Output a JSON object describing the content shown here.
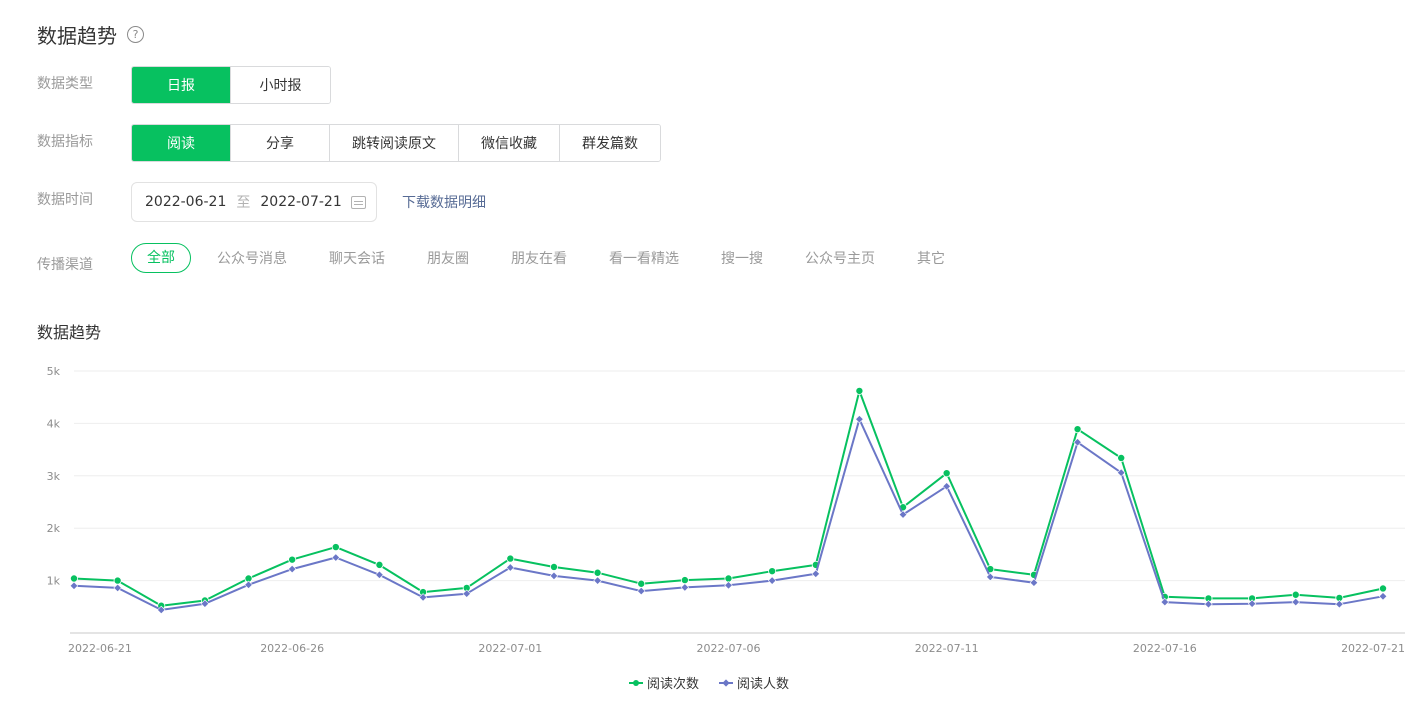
{
  "header": {
    "title": "数据趋势",
    "help_icon": "question-circle-icon"
  },
  "filters": {
    "type": {
      "label": "数据类型",
      "options": [
        "日报",
        "小时报"
      ],
      "selected": "日报"
    },
    "metric": {
      "label": "数据指标",
      "options": [
        "阅读",
        "分享",
        "跳转阅读原文",
        "微信收藏",
        "群发篇数"
      ],
      "selected": "阅读"
    },
    "time": {
      "label": "数据时间",
      "start": "2022-06-21",
      "separator": "至",
      "end": "2022-07-21",
      "calendar_icon": "calendar-icon",
      "download_label": "下载数据明细"
    },
    "channel": {
      "label": "传播渠道",
      "options": [
        "全部",
        "公众号消息",
        "聊天会话",
        "朋友圈",
        "朋友在看",
        "看一看精选",
        "搜一搜",
        "公众号主页",
        "其它"
      ],
      "selected": "全部"
    }
  },
  "colors": {
    "accent": "#07c160",
    "series2": "#6b77c7",
    "link": "#576b95"
  },
  "chart_data": {
    "type": "line",
    "title": "数据趋势",
    "x": [
      "2022-06-21",
      "2022-06-22",
      "2022-06-23",
      "2022-06-24",
      "2022-06-25",
      "2022-06-26",
      "2022-06-27",
      "2022-06-28",
      "2022-06-29",
      "2022-06-30",
      "2022-07-01",
      "2022-07-02",
      "2022-07-03",
      "2022-07-04",
      "2022-07-05",
      "2022-07-06",
      "2022-07-07",
      "2022-07-08",
      "2022-07-09",
      "2022-07-10",
      "2022-07-11",
      "2022-07-12",
      "2022-07-13",
      "2022-07-14",
      "2022-07-15",
      "2022-07-16",
      "2022-07-17",
      "2022-07-18",
      "2022-07-19",
      "2022-07-20",
      "2022-07-21"
    ],
    "x_tick_labels": [
      "2022-06-21",
      "2022-06-26",
      "2022-07-01",
      "2022-07-06",
      "2022-07-11",
      "2022-07-16",
      "2022-07-21"
    ],
    "y_tick_labels": [
      "1k",
      "2k",
      "3k",
      "4k",
      "5k"
    ],
    "ylim": [
      0,
      5000
    ],
    "grid": true,
    "legend_position": "bottom",
    "series": [
      {
        "name": "阅读次数",
        "color": "#07c160",
        "marker": "circle",
        "values": [
          1040,
          1000,
          520,
          620,
          1040,
          1400,
          1640,
          1300,
          780,
          860,
          1420,
          1260,
          1150,
          940,
          1010,
          1040,
          1180,
          1300,
          4620,
          2400,
          3050,
          1220,
          1110,
          3890,
          3340,
          690,
          660,
          660,
          730,
          670,
          850
        ]
      },
      {
        "name": "阅读人数",
        "color": "#6b77c7",
        "marker": "diamond",
        "values": [
          900,
          860,
          440,
          560,
          920,
          1220,
          1440,
          1110,
          680,
          750,
          1250,
          1090,
          1000,
          800,
          870,
          910,
          1000,
          1130,
          4080,
          2260,
          2800,
          1070,
          960,
          3640,
          3060,
          590,
          550,
          560,
          590,
          550,
          700
        ]
      }
    ]
  }
}
